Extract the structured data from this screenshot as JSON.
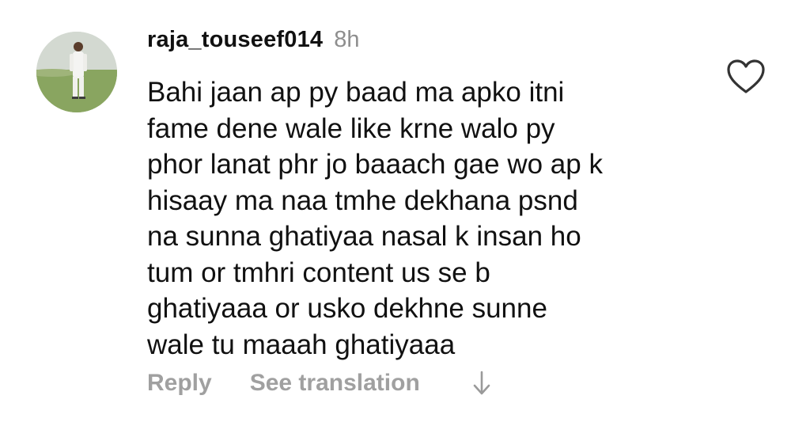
{
  "comment": {
    "username": "raja_touseef014",
    "timestamp": "8h",
    "text": "Bahi jaan ap py baad ma apko itni\nfame dene wale like krne walo py\nphor lanat phr jo baaach gae wo ap k\nhisaay ma naa tmhe dekhana psnd\nna sunna ghatiyaa nasal k insan ho\ntum or tmhri content us se b\nghatiyaaa or usko dekhne sunne\nwale tu maaah ghatiyaaa",
    "avatar_icon": "profile-photo-icon",
    "like_icon": "heart-outline-icon"
  },
  "actions": {
    "reply_label": "Reply",
    "translate_label": "See translation",
    "arrow_icon": "arrow-down-icon"
  },
  "colors": {
    "text_primary": "#111111",
    "text_secondary": "#8e8e8e",
    "action_text": "#a0a0a0",
    "background": "#ffffff"
  }
}
